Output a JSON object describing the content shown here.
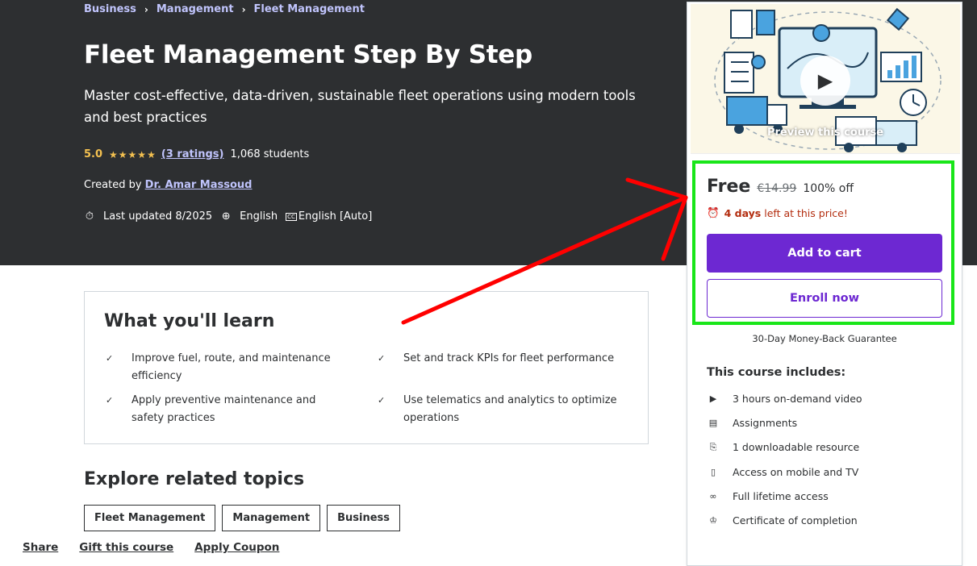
{
  "breadcrumbs": [
    "Business",
    "Management",
    "Fleet Management"
  ],
  "course": {
    "title": "Fleet Management Step By Step",
    "subtitle": "Master cost-effective, data-driven, sustainable fleet operations using modern tools and best practices",
    "rating": "5.0",
    "ratings_count": "(3 ratings)",
    "students": "1,068 students",
    "created_by_label": "Created by",
    "instructor": "Dr. Amar Massoud",
    "last_updated": "Last updated 8/2025",
    "language": "English",
    "captions": "English [Auto]"
  },
  "learn": {
    "heading": "What you'll learn",
    "items": [
      "Improve fuel, route, and maintenance efficiency",
      "Set and track KPIs for fleet performance",
      "Apply preventive maintenance and safety practices",
      "Use telematics and analytics to optimize operations"
    ]
  },
  "related": {
    "heading": "Explore related topics",
    "tags": [
      "Fleet Management",
      "Management",
      "Business"
    ]
  },
  "sidebar": {
    "preview_label": "Preview this course",
    "price": "Free",
    "original_price": "€14.99",
    "discount": "100% off",
    "timer_days": "4 days",
    "timer_text": "left at this price!",
    "add_to_cart": "Add to cart",
    "enroll_now": "Enroll now",
    "guarantee": "30-Day Money-Back Guarantee",
    "includes_heading": "This course includes:",
    "includes": [
      {
        "icon": "video-icon",
        "text": "3 hours on-demand video"
      },
      {
        "icon": "assignment-icon",
        "text": "Assignments"
      },
      {
        "icon": "file-download-icon",
        "text": "1 downloadable resource"
      },
      {
        "icon": "mobile-icon",
        "text": "Access on mobile and TV"
      },
      {
        "icon": "infinity-icon",
        "text": "Full lifetime access"
      },
      {
        "icon": "trophy-icon",
        "text": "Certificate of completion"
      }
    ],
    "links": [
      "Share",
      "Gift this course",
      "Apply Coupon"
    ]
  },
  "colors": {
    "hero_bg": "#2d2f31",
    "brand_purple": "#6d28d2",
    "link_lavender": "#c0c4fc",
    "star_gold": "#f4c150",
    "highlight_green": "#19e619",
    "annotation_red": "#ff0000"
  }
}
